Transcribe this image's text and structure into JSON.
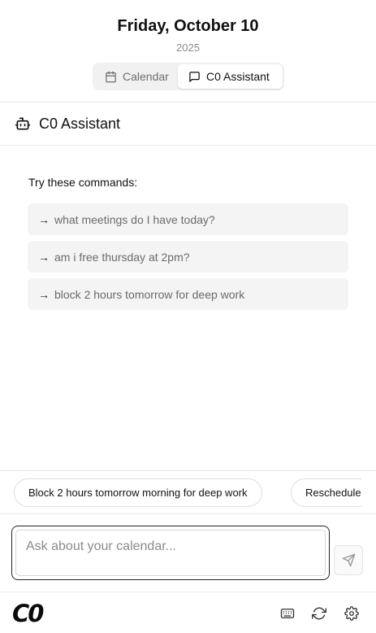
{
  "header": {
    "date_title": "Friday, October 10",
    "year": "2025",
    "tabs": [
      {
        "label": "Calendar",
        "icon": "calendar-icon",
        "active": false
      },
      {
        "label": "C0 Assistant",
        "icon": "message-square-icon",
        "active": true
      }
    ]
  },
  "assistant": {
    "title": "C0 Assistant",
    "icon": "bot-icon",
    "commands_heading": "Try these commands:",
    "commands": [
      {
        "arrow": "→",
        "text": "what meetings do I have today?"
      },
      {
        "arrow": "→",
        "text": "am i free thursday at 2pm?"
      },
      {
        "arrow": "→",
        "text": "block 2 hours tomorrow for deep work"
      }
    ]
  },
  "suggestions": [
    "Block 2 hours tomorrow morning for deep work",
    "Reschedule"
  ],
  "input": {
    "placeholder": "Ask about your calendar...",
    "value": ""
  },
  "footer": {
    "logo_text": "C0",
    "icons": [
      "keyboard-icon",
      "refresh-icon",
      "settings-icon"
    ]
  },
  "colors": {
    "text": "#111111",
    "muted": "#8a8a8a",
    "command_bg": "#f4f4f4",
    "border": "#e8e8e8",
    "segment_bg": "#f1f1f1"
  }
}
